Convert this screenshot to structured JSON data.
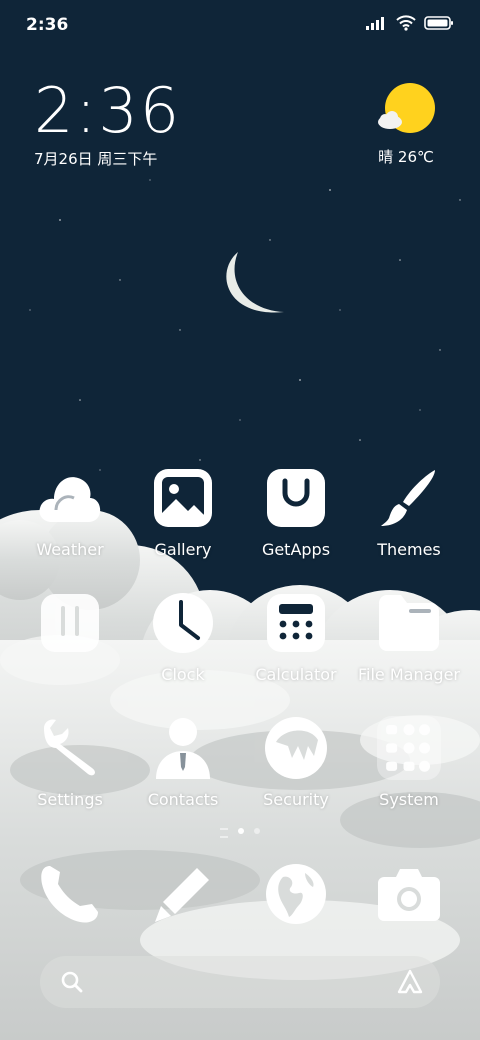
{
  "status_bar": {
    "time": "2:36"
  },
  "clock_widget": {
    "time": "2:36",
    "date": "7月26日 周三下午"
  },
  "weather_widget": {
    "condition": "晴 26℃"
  },
  "apps": {
    "weather": "Weather",
    "gallery": "Gallery",
    "getapps": "GetApps",
    "themes": "Themes",
    "clock": "Clock",
    "calculator": "Calculator",
    "file_manager": "File Manager",
    "settings": "Settings",
    "contacts": "Contacts",
    "security": "Security",
    "system": "System"
  },
  "page_indicator": {
    "pages": 3,
    "active": 2
  },
  "dock_icons": [
    "phone-icon",
    "notes-pencil-icon",
    "browser-globe-icon",
    "camera-icon"
  ],
  "colors": {
    "night_sky": "#0f2538",
    "sun": "#ffd21e",
    "icon_white": "#ffffff"
  }
}
